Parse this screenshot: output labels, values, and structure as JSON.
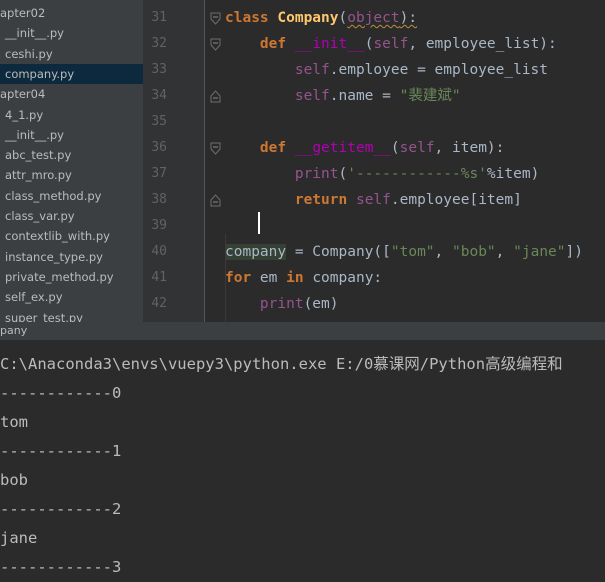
{
  "sidebar": {
    "items": [
      {
        "label": "apter02",
        "kind": "folder",
        "selected": false
      },
      {
        "label": "__init__.py",
        "kind": "file",
        "selected": false
      },
      {
        "label": "ceshi.py",
        "kind": "file",
        "selected": false
      },
      {
        "label": "company.py",
        "kind": "file",
        "selected": true
      },
      {
        "label": "apter04",
        "kind": "folder",
        "selected": false
      },
      {
        "label": "4_1.py",
        "kind": "file",
        "selected": false
      },
      {
        "label": "__init__.py",
        "kind": "file",
        "selected": false
      },
      {
        "label": "abc_test.py",
        "kind": "file",
        "selected": false
      },
      {
        "label": "attr_mro.py",
        "kind": "file",
        "selected": false
      },
      {
        "label": "class_method.py",
        "kind": "file",
        "selected": false
      },
      {
        "label": "class_var.py",
        "kind": "file",
        "selected": false
      },
      {
        "label": "contextlib_with.py",
        "kind": "file",
        "selected": false
      },
      {
        "label": "instance_type.py",
        "kind": "file",
        "selected": false
      },
      {
        "label": "private_method.py",
        "kind": "file",
        "selected": false
      },
      {
        "label": "self_ex.py",
        "kind": "file",
        "selected": false
      },
      {
        "label": "super_test.py",
        "kind": "file",
        "selected": false
      }
    ]
  },
  "editor": {
    "lines": [
      {
        "num": "31",
        "tokens": [
          {
            "t": "class",
            "c": "kw"
          },
          {
            "t": " ",
            "c": "plain"
          },
          {
            "t": "Company",
            "c": "cls"
          },
          {
            "t": "(",
            "c": "plain"
          },
          {
            "t": "object",
            "c": "self"
          },
          {
            "t": "):",
            "c": "plain"
          }
        ]
      },
      {
        "num": "32",
        "tokens": [
          {
            "t": "    ",
            "c": "plain"
          },
          {
            "t": "def",
            "c": "kw"
          },
          {
            "t": " ",
            "c": "plain"
          },
          {
            "t": "__init__",
            "c": "magic"
          },
          {
            "t": "(",
            "c": "plain"
          },
          {
            "t": "self",
            "c": "self"
          },
          {
            "t": ", employee_list):",
            "c": "plain"
          }
        ]
      },
      {
        "num": "33",
        "tokens": [
          {
            "t": "        ",
            "c": "plain"
          },
          {
            "t": "self",
            "c": "self"
          },
          {
            "t": ".employee = employee_list",
            "c": "plain"
          }
        ]
      },
      {
        "num": "34",
        "tokens": [
          {
            "t": "        ",
            "c": "plain"
          },
          {
            "t": "self",
            "c": "self"
          },
          {
            "t": ".name = ",
            "c": "plain"
          },
          {
            "t": "\"裴建斌\"",
            "c": "str"
          }
        ]
      },
      {
        "num": "35",
        "tokens": []
      },
      {
        "num": "36",
        "tokens": [
          {
            "t": "    ",
            "c": "plain"
          },
          {
            "t": "def",
            "c": "kw"
          },
          {
            "t": " ",
            "c": "plain"
          },
          {
            "t": "__getitem__",
            "c": "magic"
          },
          {
            "t": "(",
            "c": "plain"
          },
          {
            "t": "self",
            "c": "self"
          },
          {
            "t": ", item):",
            "c": "plain"
          }
        ]
      },
      {
        "num": "37",
        "tokens": [
          {
            "t": "        ",
            "c": "plain"
          },
          {
            "t": "print",
            "c": "self"
          },
          {
            "t": "(",
            "c": "plain"
          },
          {
            "t": "'------------%s'",
            "c": "str"
          },
          {
            "t": "%item)",
            "c": "plain"
          }
        ]
      },
      {
        "num": "38",
        "tokens": [
          {
            "t": "        ",
            "c": "plain"
          },
          {
            "t": "return",
            "c": "kw"
          },
          {
            "t": " ",
            "c": "plain"
          },
          {
            "t": "self",
            "c": "self"
          },
          {
            "t": ".employee[item]",
            "c": "plain"
          }
        ]
      },
      {
        "num": "39",
        "tokens": []
      },
      {
        "num": "40",
        "tokens": [
          {
            "t": "company",
            "c": "varhl"
          },
          {
            "t": " = Company([",
            "c": "plain"
          },
          {
            "t": "\"tom\"",
            "c": "str"
          },
          {
            "t": ", ",
            "c": "plain"
          },
          {
            "t": "\"bob\"",
            "c": "str"
          },
          {
            "t": ", ",
            "c": "plain"
          },
          {
            "t": "\"jane\"",
            "c": "str"
          },
          {
            "t": "])",
            "c": "plain"
          }
        ]
      },
      {
        "num": "41",
        "tokens": [
          {
            "t": "for",
            "c": "kw"
          },
          {
            "t": " em ",
            "c": "plain"
          },
          {
            "t": "in",
            "c": "kw"
          },
          {
            "t": " company:",
            "c": "plain"
          }
        ]
      },
      {
        "num": "42",
        "tokens": [
          {
            "t": "    ",
            "c": "plain"
          },
          {
            "t": "print",
            "c": "self"
          },
          {
            "t": "(em)",
            "c": "plain"
          }
        ]
      }
    ]
  },
  "run": {
    "tab_label": "pany",
    "output": [
      "C:\\Anaconda3\\envs\\vuepy3\\python.exe E:/0慕课网/Python高级编程和",
      "------------0",
      "tom",
      "------------1",
      "bob",
      "------------2",
      "jane",
      "------------3"
    ]
  },
  "colors": {
    "keyword": "#cc7832",
    "class_name": "#ffc66d",
    "self": "#94558d",
    "string": "#6a8759",
    "magic": "#b200b2",
    "text": "#a9b7c6",
    "sidebar_bg": "#3c3f41",
    "editor_bg": "#2b2b2b",
    "selection": "#0d293e"
  }
}
